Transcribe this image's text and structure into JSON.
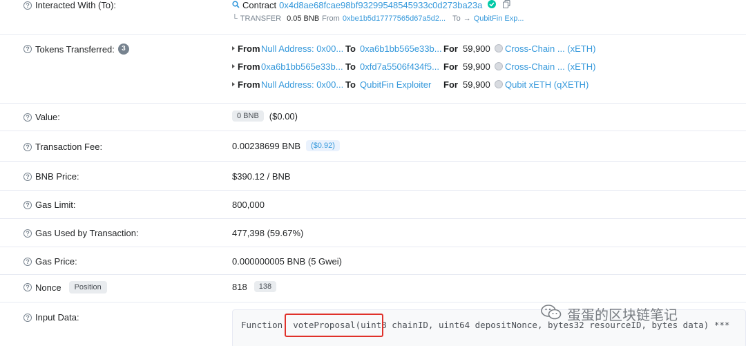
{
  "interacted": {
    "label": "Interacted With (To):",
    "contract_word": "Contract",
    "contract_address": "0x4d8ae68fcae98bf93299548545933c0d273ba23a",
    "transfer_prefix": "TRANSFER",
    "transfer_amount": "0.05 BNB",
    "from_word": "From",
    "from_address": "0xbe1b5d17777565d67a5d2...",
    "to_word": "To",
    "to_name": "QubitFin Exp..."
  },
  "tokens": {
    "label": "Tokens Transferred:",
    "count": "3",
    "rows": [
      {
        "from_word": "From",
        "from": "Null Address: 0x00...",
        "to_word": "To",
        "to": "0xa6b1bb565e33b...",
        "for_word": "For",
        "amount": "59,900",
        "token": "Cross-Chain ... (xETH)"
      },
      {
        "from_word": "From",
        "from": "0xa6b1bb565e33b...",
        "to_word": "To",
        "to": "0xfd7a5506f434f5...",
        "for_word": "For",
        "amount": "59,900",
        "token": "Cross-Chain ... (xETH)"
      },
      {
        "from_word": "From",
        "from": "Null Address: 0x00...",
        "to_word": "To",
        "to": "QubitFin Exploiter",
        "for_word": "For",
        "amount": "59,900",
        "token": "Qubit xETH (qXETH)"
      }
    ]
  },
  "value": {
    "label": "Value:",
    "pill": "0 BNB",
    "usd": "($0.00)"
  },
  "fee": {
    "label": "Transaction Fee:",
    "amount": "0.00238699 BNB",
    "usd": "($0.92)"
  },
  "bnb_price": {
    "label": "BNB Price:",
    "value": "$390.12 / BNB"
  },
  "gas_limit": {
    "label": "Gas Limit:",
    "value": "800,000"
  },
  "gas_used": {
    "label": "Gas Used by Transaction:",
    "value": "477,398 (59.67%)"
  },
  "gas_price": {
    "label": "Gas Price:",
    "value": "0.000000005 BNB (5 Gwei)"
  },
  "nonce": {
    "label": "Nonce",
    "position_label": "Position",
    "value": "818",
    "position": "138"
  },
  "input": {
    "label": "Input Data:",
    "text": "Function: voteProposal(uint8 chainID, uint64 depositNonce, bytes32 resourceID, bytes data) ***"
  },
  "watermark": {
    "text": "蛋蛋的区块链笔记"
  },
  "colors": {
    "link": "#3498db",
    "highlight": "#e0312a",
    "check": "#00c9a7"
  }
}
